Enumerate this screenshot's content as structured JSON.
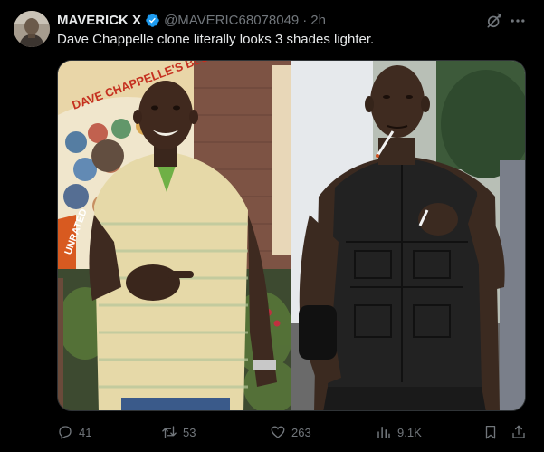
{
  "author": {
    "name": "MAVERICK X",
    "handle": "@MAVERIC68078049",
    "separator": "·",
    "time": "2h"
  },
  "tweet": {
    "text": "Dave Chappelle clone literally looks 3 shades lighter."
  },
  "media": {
    "left_sign_text": "DAVE CHAPPELLE'S BLOCK PARTY",
    "left_sign_edge_text": "UNRATED"
  },
  "actions": {
    "replies": "41",
    "reposts": "53",
    "likes": "263",
    "views": "9.1K"
  },
  "icons": [
    "verified-badge-icon",
    "grok-icon",
    "more-icon",
    "reply-icon",
    "repost-icon",
    "like-icon",
    "views-icon",
    "bookmark-icon",
    "share-icon"
  ],
  "colors": {
    "background": "#000000",
    "text_primary": "#e7e9ea",
    "text_secondary": "#71767b",
    "verified_blue": "#1d9bf0"
  }
}
